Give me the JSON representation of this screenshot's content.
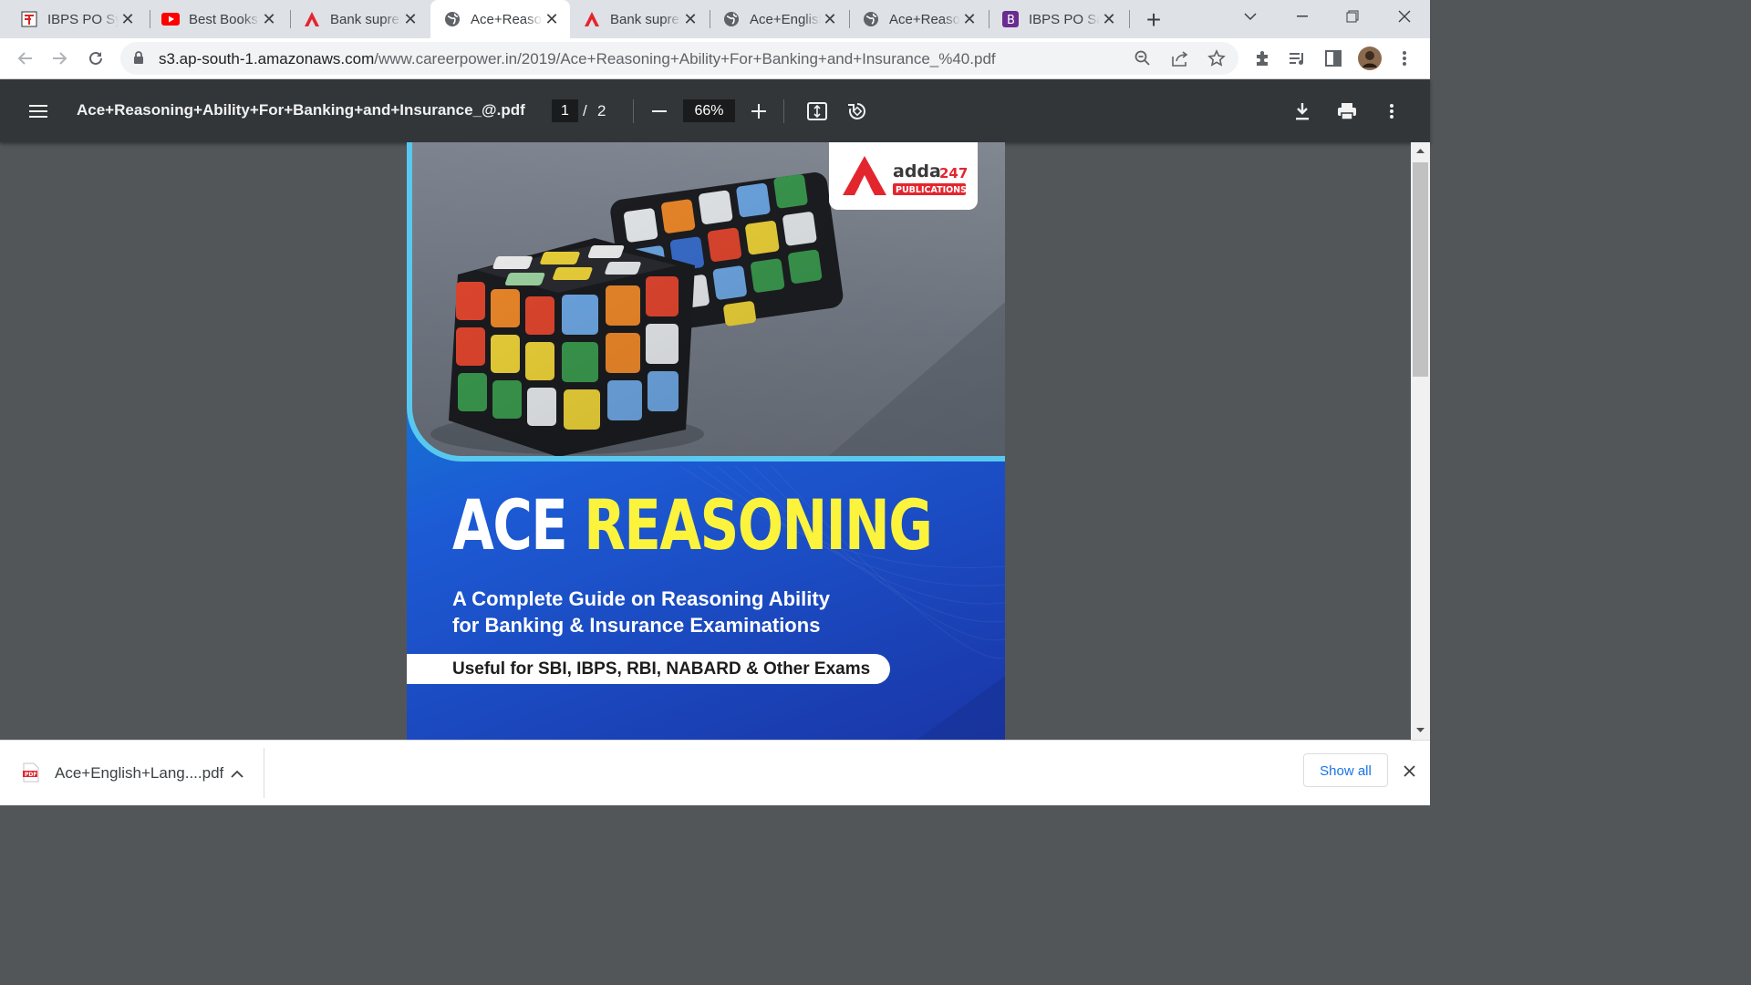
{
  "tabs": [
    {
      "title": "IBPS PO Syllabus",
      "icon": "site-logo-icon"
    },
    {
      "title": "Best Books",
      "icon": "youtube-icon"
    },
    {
      "title": "Bank supremo",
      "icon": "adda-icon"
    },
    {
      "title": "Ace+Reasoning",
      "icon": "globe-icon",
      "active": true
    },
    {
      "title": "Bank supremo",
      "icon": "adda-icon"
    },
    {
      "title": "Ace+English",
      "icon": "globe-icon"
    },
    {
      "title": "Ace+Reasoning",
      "icon": "globe-icon"
    },
    {
      "title": "IBPS PO Salary",
      "icon": "bytes-icon"
    }
  ],
  "tab_close": "✕",
  "new_tab": "+",
  "url": {
    "host": "s3.ap-south-1.amazonaws.com",
    "path": "/www.careerpower.in/2019/Ace+Reasoning+Ability+For+Banking+and+Insurance_%40.pdf"
  },
  "pdf": {
    "title": "Ace+Reasoning+Ability+For+Banking+and+Insurance_@.pdf",
    "current_page": "1",
    "page_sep": "/",
    "total_pages": "2",
    "zoom": "66%"
  },
  "cover": {
    "publisher": "adda",
    "publisher_num": "247",
    "publisher_sub": "PUBLICATIONS",
    "title_white": "ACE",
    "title_yellow": "REASONING",
    "subtitle_line1": "A Complete Guide on Reasoning Ability",
    "subtitle_line2": "for Banking & Insurance Examinations",
    "useful": "Useful for SBI, IBPS, RBI, NABARD & Other Exams"
  },
  "download": {
    "filename": "Ace+English+Lang....pdf",
    "show_all": "Show all"
  },
  "colors": {
    "accent_yellow": "#fcf33c",
    "adda_red": "#e3262e",
    "cover_blue": "#1c5bd5"
  }
}
